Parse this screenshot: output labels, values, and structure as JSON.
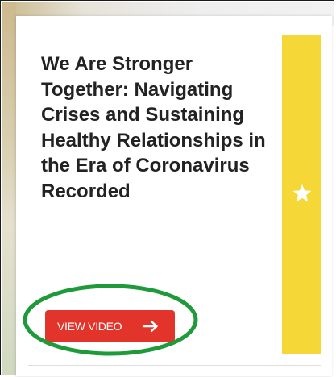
{
  "card": {
    "title": "We Are Stronger Together: Navigating Crises and Sustaining Healthy Relationships in the Era of Coronavirus Recorded",
    "button_label": "VIEW VIDEO",
    "button_icon": "arrow-right-icon",
    "accent_icon": "star-icon"
  },
  "colors": {
    "accent": "#f5d738",
    "button": "#e2342a",
    "highlight": "#1f9a3a",
    "title": "#222222"
  }
}
